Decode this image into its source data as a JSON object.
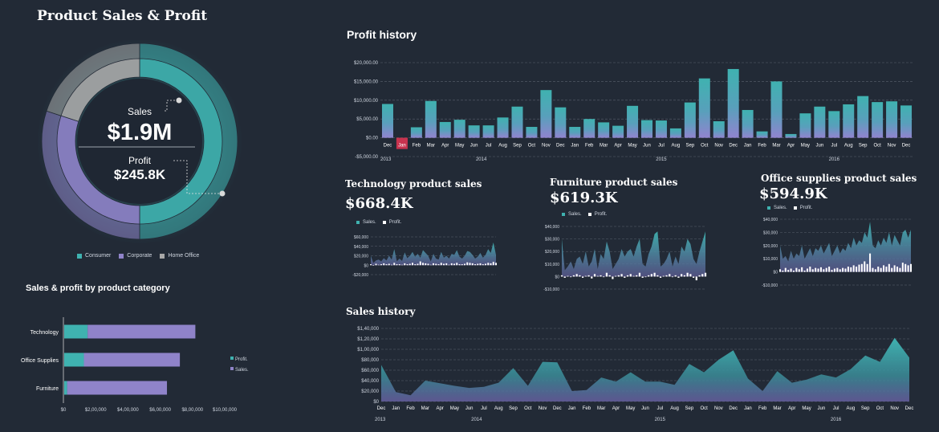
{
  "dashboard": {
    "title": "Product Sales & Profit",
    "sales_label": "Sales",
    "sales_value": "$1.9M",
    "profit_label": "Profit",
    "profit_value": "$245.8K"
  },
  "colors": {
    "background": "#222a36",
    "teal": "#3fb2b0",
    "purple": "#8f83c9",
    "gray": "#a8a8a8",
    "dark_teal": "#0f3e4a",
    "highlight": "#c8334f",
    "white": "#ffffff"
  },
  "chart_data": [
    {
      "id": "donut",
      "type": "pie",
      "legend": [
        "Consumer",
        "Corporate",
        "Home Office"
      ],
      "legend_position": "bottom",
      "rings": [
        {
          "series": "Sales",
          "values": [
            0.5,
            0.3,
            0.2
          ]
        },
        {
          "series": "Profit",
          "values": [
            0.5,
            0.3,
            0.2
          ]
        }
      ]
    },
    {
      "id": "category_bar",
      "type": "bar",
      "title": "Sales & profit by product category",
      "orientation": "horizontal",
      "categories": [
        "Technology",
        "Office Supplies",
        "Furniture"
      ],
      "series": [
        {
          "name": "Profit.",
          "values": [
            145000,
            122000,
            18000
          ]
        },
        {
          "name": "Sales.",
          "values": [
            668000,
            595000,
            619000
          ]
        }
      ],
      "xlim": [
        0,
        1000000
      ],
      "x_ticks": [
        "$0",
        "$2,00,000",
        "$4,00,000",
        "$6,00,000",
        "$8,00,000",
        "$10,00,000"
      ],
      "legend_position": "right",
      "stacked": true
    },
    {
      "id": "profit_history",
      "type": "bar",
      "title": "Profit history",
      "categories": [
        "Dec",
        "Jan",
        "Feb",
        "Mar",
        "Apr",
        "May",
        "Jun",
        "Jul",
        "Aug",
        "Sep",
        "Oct",
        "Nov",
        "Dec",
        "Jan",
        "Feb",
        "Mar",
        "Apr",
        "May",
        "Jun",
        "Jul",
        "Aug",
        "Sep",
        "Oct",
        "Nov",
        "Dec",
        "Jan",
        "Feb",
        "Mar",
        "Apr",
        "May",
        "Jun",
        "Jul",
        "Aug",
        "Sep",
        "Oct",
        "Nov",
        "Dec"
      ],
      "years": [
        {
          "label": "2013",
          "at": 0
        },
        {
          "label": "2014",
          "at": 6.5
        },
        {
          "label": "2015",
          "at": 19
        },
        {
          "label": "2016",
          "at": 31
        }
      ],
      "values": [
        9000,
        -1500,
        2800,
        9800,
        4200,
        4800,
        3300,
        3300,
        5400,
        8300,
        2900,
        12700,
        8100,
        2900,
        5000,
        4100,
        3200,
        8500,
        4700,
        4600,
        2500,
        9400,
        15800,
        4400,
        18300,
        7400,
        1700,
        15000,
        1000,
        6500,
        8300,
        7100,
        8900,
        11100,
        9500,
        9700,
        8600
      ],
      "highlight_index": 1,
      "ylim": [
        -5000,
        20000
      ],
      "y_ticks": [
        "-$5,000.00",
        "$0.00",
        "$5,000.00",
        "$10,000.00",
        "$15,000.00",
        "$20,000.00"
      ],
      "grid": true
    },
    {
      "id": "tech_sales",
      "type": "area",
      "title": "Technology product sales",
      "total": "$668.4K",
      "series_names": [
        "Sales.",
        "Profit."
      ],
      "sales": [
        20000,
        5000,
        10000,
        12000,
        8000,
        15000,
        10000,
        20000,
        12000,
        34000,
        8000,
        14000,
        9000,
        27000,
        15000,
        20000,
        28000,
        18000,
        24000,
        16000,
        32000,
        26000,
        20000,
        8000,
        24000,
        14000,
        12000,
        28000,
        16000,
        20000,
        14000,
        24000,
        22000,
        32000,
        18000,
        14000,
        20000,
        30000,
        28000,
        22000,
        14000,
        18000,
        26000,
        16000,
        22000,
        34000,
        26000,
        48000,
        22000
      ],
      "profit": [
        2000,
        -1000,
        3000,
        1000,
        2000,
        4000,
        2000,
        3000,
        1000,
        5000,
        2000,
        2000,
        1000,
        4000,
        2000,
        3000,
        5000,
        2000,
        3000,
        8000,
        5000,
        4000,
        3000,
        1000,
        4000,
        3000,
        2000,
        5000,
        3000,
        4000,
        1000,
        4000,
        3000,
        5000,
        2000,
        2000,
        3000,
        6000,
        5000,
        4000,
        2000,
        3000,
        4000,
        2000,
        3000,
        5000,
        4000,
        7000,
        5000
      ],
      "ylim": [
        -20000,
        60000
      ],
      "y_ticks": [
        "-$20,000",
        "$0",
        "$20,000",
        "$40,000",
        "$60,000"
      ],
      "grid": true
    },
    {
      "id": "furniture_sales",
      "type": "area",
      "title": "Furniture product sales",
      "total": "$619.3K",
      "series_names": [
        "Sales.",
        "Profit."
      ],
      "sales": [
        30000,
        5000,
        8000,
        12000,
        6000,
        14000,
        16000,
        10000,
        20000,
        8000,
        12000,
        22000,
        6000,
        18000,
        14000,
        28000,
        20000,
        6000,
        10000,
        14000,
        22000,
        16000,
        20000,
        22000,
        16000,
        24000,
        30000,
        10000,
        8000,
        18000,
        24000,
        34000,
        36000,
        8000,
        10000,
        14000,
        20000,
        8000,
        16000,
        10000,
        24000,
        20000,
        30000,
        26000,
        14000,
        10000,
        20000,
        28000,
        36000
      ],
      "profit": [
        1000,
        -1000,
        500,
        -500,
        1000,
        2000,
        1000,
        -1000,
        500,
        1000,
        -1500,
        2000,
        500,
        1000,
        -500,
        3000,
        1000,
        -2000,
        500,
        1000,
        2000,
        -1000,
        1000,
        2000,
        500,
        1000,
        3000,
        -1000,
        -500,
        1000,
        2000,
        3000,
        1000,
        -1000,
        500,
        1000,
        2000,
        -500,
        1000,
        -1000,
        2000,
        1000,
        3000,
        2000,
        -1000,
        -3000,
        1000,
        2000,
        3000
      ],
      "ylim": [
        -10000,
        40000
      ],
      "y_ticks": [
        "-$10,000",
        "$0",
        "$10,000",
        "$20,000",
        "$30,000",
        "$40,000"
      ],
      "grid": true
    },
    {
      "id": "office_sales",
      "type": "area",
      "title": "Office supplies product sales",
      "total": "$594.9K",
      "series_names": [
        "Sales.",
        "Profit."
      ],
      "sales": [
        20000,
        10000,
        12000,
        8000,
        16000,
        10000,
        14000,
        12000,
        20000,
        10000,
        14000,
        18000,
        12000,
        18000,
        16000,
        20000,
        14000,
        18000,
        22000,
        12000,
        16000,
        20000,
        14000,
        18000,
        16000,
        22000,
        18000,
        26000,
        20000,
        24000,
        22000,
        30000,
        26000,
        38000,
        20000,
        18000,
        24000,
        20000,
        26000,
        22000,
        30000,
        20000,
        28000,
        24000,
        20000,
        30000,
        32000,
        26000,
        32000
      ],
      "profit": [
        2000,
        1000,
        3000,
        1500,
        2500,
        1000,
        3000,
        2000,
        3500,
        1000,
        2500,
        4000,
        2000,
        3000,
        2500,
        3500,
        2000,
        3000,
        4000,
        1500,
        2500,
        3000,
        2000,
        3000,
        2500,
        4000,
        3500,
        5000,
        4000,
        5500,
        6000,
        8000,
        6000,
        14000,
        3000,
        2000,
        4000,
        3000,
        5000,
        4000,
        6000,
        3000,
        5000,
        4000,
        3000,
        7000,
        6000,
        5000,
        6000
      ],
      "ylim": [
        -10000,
        40000
      ],
      "y_ticks": [
        "-$10,000",
        "$0",
        "$10,000",
        "$20,000",
        "$30,000",
        "$40,000"
      ],
      "grid": true
    },
    {
      "id": "sales_history",
      "type": "area",
      "title": "Sales history",
      "categories": [
        "Dec",
        "Jan",
        "Feb",
        "Mar",
        "Apr",
        "May",
        "Jun",
        "Jul",
        "Aug",
        "Sep",
        "Oct",
        "Nov",
        "Dec",
        "Jan",
        "Feb",
        "Mar",
        "Apr",
        "May",
        "Jun",
        "Jul",
        "Aug",
        "Sep",
        "Oct",
        "Nov",
        "Dec",
        "Jan",
        "Feb",
        "Mar",
        "Apr",
        "May",
        "Jun",
        "Jul",
        "Aug",
        "Sep",
        "Oct",
        "Nov",
        "Dec"
      ],
      "years": [
        {
          "label": "2013",
          "at": 0
        },
        {
          "label": "2014",
          "at": 6.5
        },
        {
          "label": "2015",
          "at": 19
        },
        {
          "label": "2016",
          "at": 31
        }
      ],
      "values": [
        70000,
        18000,
        12000,
        40000,
        35000,
        30000,
        26000,
        28000,
        36000,
        64000,
        30000,
        76000,
        75000,
        20000,
        22000,
        46000,
        38000,
        56000,
        38000,
        38000,
        32000,
        72000,
        56000,
        80000,
        98000,
        44000,
        20000,
        58000,
        36000,
        42000,
        52000,
        46000,
        62000,
        88000,
        76000,
        122000,
        84000
      ],
      "ylim": [
        0,
        140000
      ],
      "y_ticks": [
        "$0",
        "$20,000",
        "$40,000",
        "$60,000",
        "$80,000",
        "$1,00,000",
        "$1,20,000",
        "$1,40,000"
      ],
      "grid": true
    }
  ]
}
